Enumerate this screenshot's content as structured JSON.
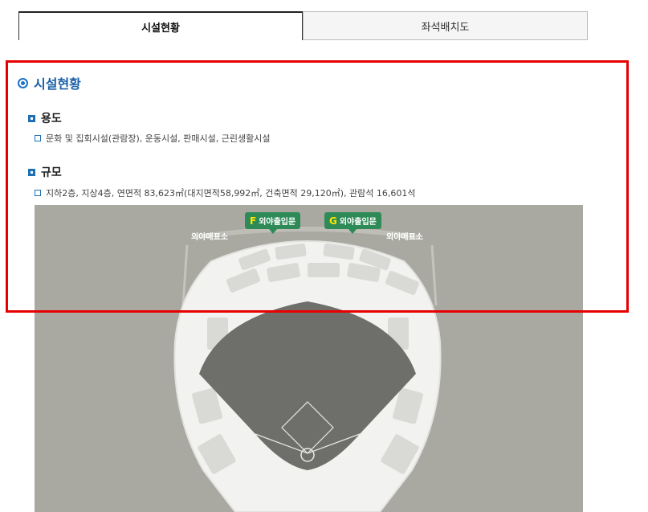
{
  "tabs": [
    {
      "label": "시설현황",
      "active": true
    },
    {
      "label": "좌석배치도",
      "active": false
    }
  ],
  "section": {
    "title": "시설현황",
    "usage": {
      "heading": "용도",
      "text": "문화 및 집회시설(관람장), 운동시설, 판매시설, 근린생활시설"
    },
    "scale": {
      "heading": "규모",
      "text": "지하2층, 지상4층, 연면적 83,623㎡(대지면적58,992㎡, 건축면적 29,120㎡), 관람석 16,601석"
    }
  },
  "map": {
    "gates": [
      {
        "letter": "F",
        "label": "외야출입문"
      },
      {
        "letter": "G",
        "label": "외야출입문"
      }
    ],
    "ticket_left": "외야매표소",
    "ticket_right": "외야매표소"
  },
  "colors": {
    "accent": "#1a5fa8",
    "highlight": "#e60000",
    "gate": "#2e8b57",
    "map_bg": "#a9a9a2",
    "field": "#6e6f6a"
  }
}
